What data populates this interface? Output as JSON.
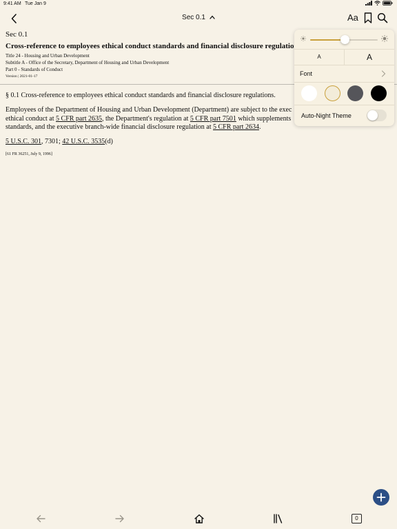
{
  "status_bar": {
    "time": "9:41 AM",
    "date": "Tue Jan 9"
  },
  "nav": {
    "title": "Sec 0.1",
    "aa_label": "Aa"
  },
  "document": {
    "section_label": "Sec 0.1",
    "heading": "Cross-reference to employees ethical conduct standards and financial disclosure regulations.",
    "title_line": "Title 24 - Housing and Urban Development",
    "subtitle_line": "Subtitle A - Office of the Secretary, Department of Housing and Urban Development",
    "part_line": "Part 0 - Standards of Conduct",
    "version_line": "Version | 2021-01-17",
    "section_title": "§ 0.1 Cross-reference to employees ethical conduct standards and financial disclosure regulations.",
    "body": {
      "t1": "Employees of the Department of Housing and Urban Development (Department) are subject to the exec",
      "t2": "ethical conduct at ",
      "link1": "5 CFR part 2635",
      "t3": ", the Department's regulation at ",
      "link2": "5 CFR part 7501",
      "t4": " which supplements",
      "t5": "standards, and the executive branch-wide financial disclosure regulation at ",
      "link3": "5 CFR part 2634",
      "t6": "."
    },
    "authority": {
      "link1": "5 U.S.C. 301",
      "t1": ", 7301; ",
      "link2": "42 U.S.C. 3535",
      "t2": "(d)"
    },
    "citation": "[61 FR 36251, July 9, 1996]"
  },
  "popover": {
    "brightness": 0.52,
    "size_small_label": "A",
    "size_large_label": "A",
    "font_label": "Font",
    "themes": [
      "white",
      "sepia",
      "gray",
      "black"
    ],
    "selected_theme": "sepia",
    "auto_night_label": "Auto-Night Theme",
    "auto_night_on": false
  },
  "colors": {
    "background": "#f7f2e7",
    "accent": "#c9a03c",
    "fab": "#2c4f86"
  },
  "toolbar": {
    "tab_count": "0"
  }
}
